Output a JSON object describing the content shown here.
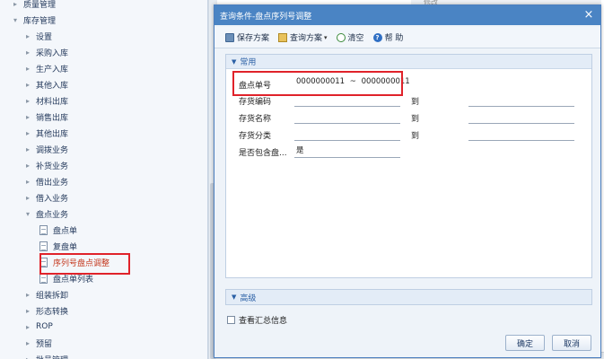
{
  "nav": {
    "items": [
      {
        "label": "质量管理",
        "level": 0,
        "expanded": false
      },
      {
        "label": "库存管理",
        "level": 0,
        "expanded": true
      },
      {
        "label": "设置",
        "level": 1,
        "expanded": false
      },
      {
        "label": "采购入库",
        "level": 1,
        "expanded": false
      },
      {
        "label": "生产入库",
        "level": 1,
        "expanded": false
      },
      {
        "label": "其他入库",
        "level": 1,
        "expanded": false
      },
      {
        "label": "材料出库",
        "level": 1,
        "expanded": false
      },
      {
        "label": "销售出库",
        "level": 1,
        "expanded": false
      },
      {
        "label": "其他出库",
        "level": 1,
        "expanded": false
      },
      {
        "label": "调拨业务",
        "level": 1,
        "expanded": false
      },
      {
        "label": "补货业务",
        "level": 1,
        "expanded": false
      },
      {
        "label": "借出业务",
        "level": 1,
        "expanded": false
      },
      {
        "label": "借入业务",
        "level": 1,
        "expanded": false
      },
      {
        "label": "盘点业务",
        "level": 1,
        "expanded": true
      },
      {
        "label": "盘点单",
        "level": 2,
        "leaf": true
      },
      {
        "label": "复盘单",
        "level": 2,
        "leaf": true
      },
      {
        "label": "序列号盘点调整",
        "level": 2,
        "leaf": true,
        "active": true
      },
      {
        "label": "盘点单列表",
        "level": 2,
        "leaf": true
      },
      {
        "label": "组装拆卸",
        "level": 1,
        "expanded": false
      },
      {
        "label": "形态转换",
        "level": 1,
        "expanded": false
      },
      {
        "label": "ROP",
        "level": 1,
        "expanded": false
      },
      {
        "label": "预留",
        "level": 1,
        "expanded": false
      },
      {
        "label": "批号管理",
        "level": 1,
        "expanded": false
      }
    ]
  },
  "background": {
    "tab_text": "修改"
  },
  "dialog": {
    "title": "查询条件-盘点序列号调整",
    "close_glyph": "×",
    "toolbar": {
      "save_scheme": "保存方案",
      "query_scheme": "查询方案",
      "clear": "清空",
      "help": "帮 助"
    },
    "common_section": "常用",
    "fields": {
      "count_no_label": "盘点单号",
      "count_no_from": "0000000011",
      "range_sep": "~",
      "count_no_to": "0000000011",
      "inv_code_label": "存货编码",
      "inv_name_label": "存货名称",
      "inv_class_label": "存货分类",
      "include_label": "是否包含盘...",
      "include_value": "是",
      "to_label": "到"
    },
    "advanced_section": "高级",
    "summary_label": "查看汇总信息",
    "ok_button": "确定",
    "cancel_button": "取消"
  },
  "colors": {
    "title_bar": "#4a84c4",
    "highlight": "#e0222a",
    "active_nav": "#c4381d"
  }
}
